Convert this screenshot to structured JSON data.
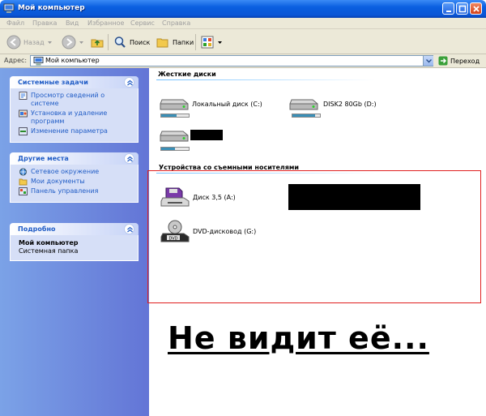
{
  "window": {
    "title": "Мой компьютер"
  },
  "menu": [
    "Файл",
    "Правка",
    "Вид",
    "Избранное",
    "Сервис",
    "Справка"
  ],
  "toolbar": {
    "back_label": "Назад",
    "search_label": "Поиск",
    "folders_label": "Папки"
  },
  "address": {
    "label": "Адрес:",
    "value": "Мой компьютер",
    "go_label": "Переход"
  },
  "sidebar": {
    "system_tasks": {
      "title": "Системные задачи",
      "items": [
        "Просмотр сведений о системе",
        "Установка и удаление программ",
        "Изменение параметра"
      ]
    },
    "other_places": {
      "title": "Другие места",
      "items": [
        "Сетевое окружение",
        "Мои документы",
        "Панель управления"
      ]
    },
    "details": {
      "title": "Подробно",
      "name": "Мой компьютер",
      "type": "Системная папка"
    }
  },
  "hard_disks": {
    "title": "Жесткие диски",
    "drives": [
      {
        "label": "Локальный диск (C:)",
        "used_fraction": 0.55,
        "bar_color": "#3a8fb7"
      },
      {
        "label": "DISK2 80Gb (D:)",
        "used_fraction": 0.82,
        "bar_color": "#3a8fb7"
      },
      {
        "label": "",
        "used_fraction": 0.5,
        "bar_color": "#3a8fb7"
      }
    ]
  },
  "removable": {
    "title": "Устройства со съемными носителями",
    "drives": [
      {
        "label": "Диск 3,5 (A:)",
        "icon": "floppy-drive-icon"
      },
      {
        "label": "DVD-дисковод (G:)",
        "icon": "dvd-drive-icon"
      }
    ]
  },
  "caption": "Не видит её...",
  "colors": {
    "highlight_box": "#e02020",
    "task_link": "#215dc6"
  }
}
